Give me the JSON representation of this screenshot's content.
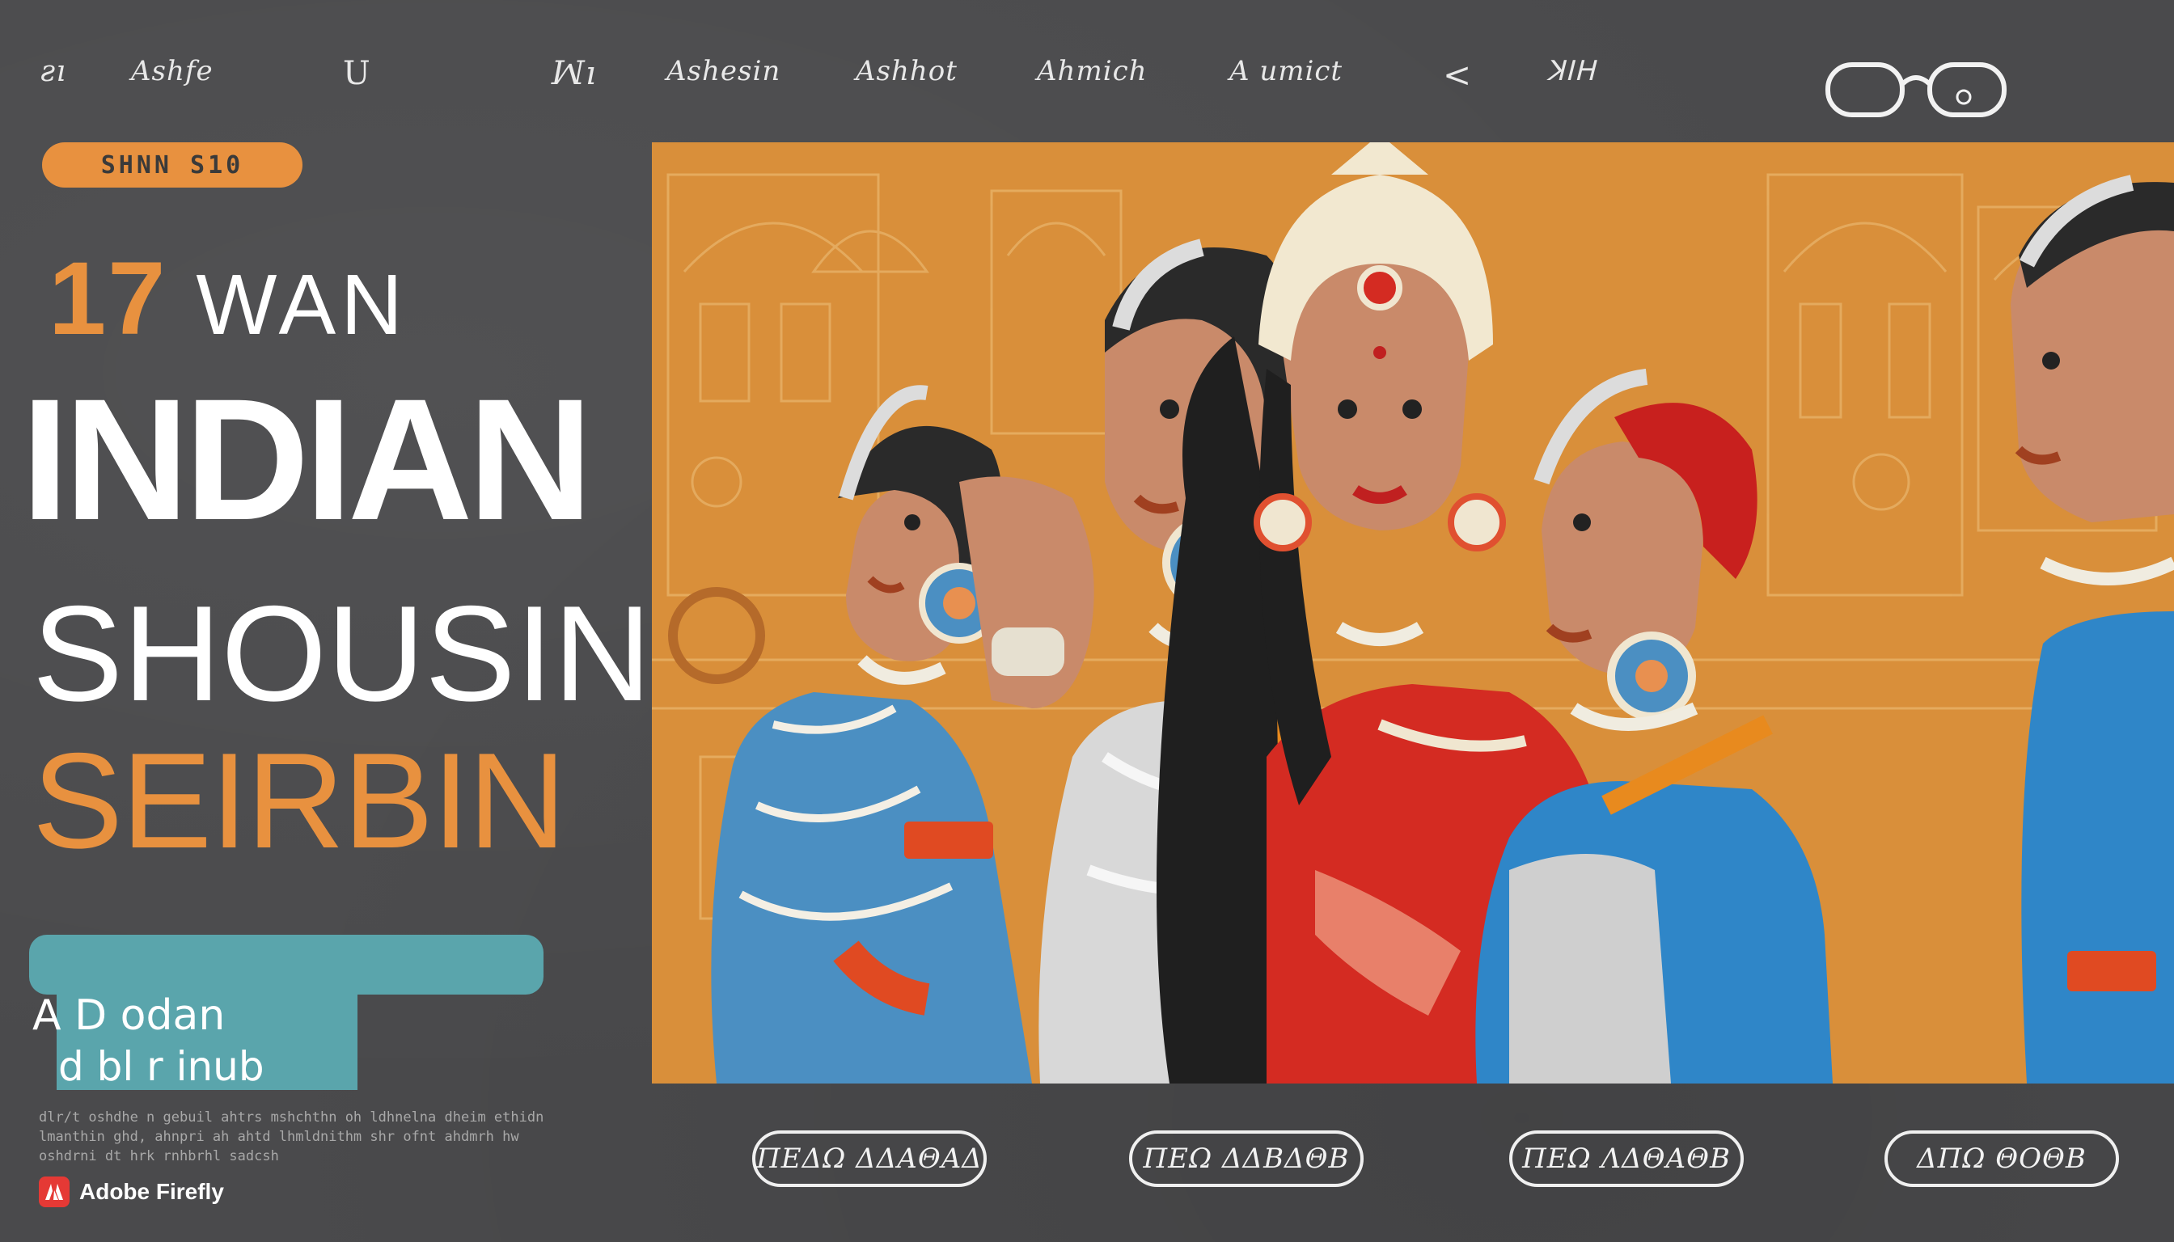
{
  "nav": {
    "items": [
      {
        "label": "Ashfe"
      },
      {
        "label": "Ashesin"
      },
      {
        "label": "Ashhot"
      },
      {
        "label": "Ahmich"
      },
      {
        "label": "A umict"
      }
    ],
    "symbols": [
      "ꙅı",
      "U",
      "ꟽı",
      "<",
      "ꓘꓲꓧ"
    ]
  },
  "left": {
    "badge": "SHNN S10",
    "small_num": "17",
    "small_word": "WAN",
    "title_line1": "INDIAN",
    "title_line2": "SHOUSIN",
    "title_line3": "SEIRBIN",
    "teal_line1": "A D odan",
    "teal_line2": "d bl r inub",
    "description": "dlr/t oshdhe n gebuil ahtrs mshchthn oh ldhnelna dheim ethidn lmanthin ghd, ahnpri ah ahtd lhmldnithm shr ofnt ahdmrh hw oshdrni dt hrk rnhbrhl sadcsh",
    "firefly": "Adobe Firefly"
  },
  "buttons": [
    {
      "label": "ΠΕΔΩ ΔΔΑΘΑΔ"
    },
    {
      "label": "ΠΕΩ ΔΔΒΔΘΒ"
    },
    {
      "label": "ΠΕΩ ΛΔΘΑΘΒ"
    },
    {
      "label": "ΔΠΩ ΘΟΘΒ"
    }
  ],
  "colors": {
    "background": "#4a4a4c",
    "accent_orange": "#e8913f",
    "accent_teal": "#5aa5ac",
    "hero_bg": "#d98f3a"
  }
}
